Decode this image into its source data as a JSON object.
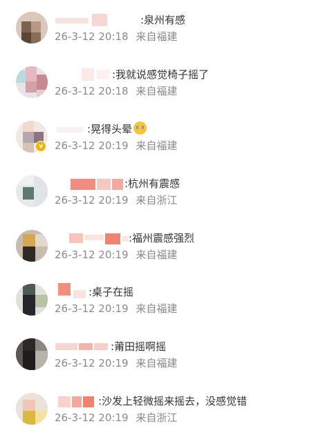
{
  "comments": [
    {
      "text": ":泉州有感",
      "date": "26-3-12 20:18",
      "source": "来自福建"
    },
    {
      "text": ":我就说感觉椅子摇了",
      "date": "26-3-12 20:18",
      "source": "来自福建"
    },
    {
      "text": ":晃得头晕",
      "date": "26-3-12 20:19",
      "source": "来自福建",
      "emoji": "crying-face-emoji"
    },
    {
      "text": ":杭州有震感",
      "date": "26-3-12 20:19",
      "source": "来自浙江"
    },
    {
      "text": ":福州震感强烈",
      "date": "26-3-12 20:19",
      "source": "来自福建"
    },
    {
      "text": ":桌子在摇",
      "date": "26-3-12 20:19",
      "source": "来自福建"
    },
    {
      "text": ":莆田摇啊摇",
      "date": "26-3-12 20:19",
      "source": "来自福建"
    },
    {
      "text": ":沙发上轻微摇来摇去，没感觉错",
      "date": "26-3-12 20:19",
      "source": "来自浙江"
    }
  ],
  "colors": {
    "comment_text": "#333333",
    "meta_text": "#8a8a8a",
    "verified_badge": "#f3b400"
  },
  "icons": {
    "verified_badge": "verified-badge-icon",
    "emoji": "crying-face-emoji"
  }
}
